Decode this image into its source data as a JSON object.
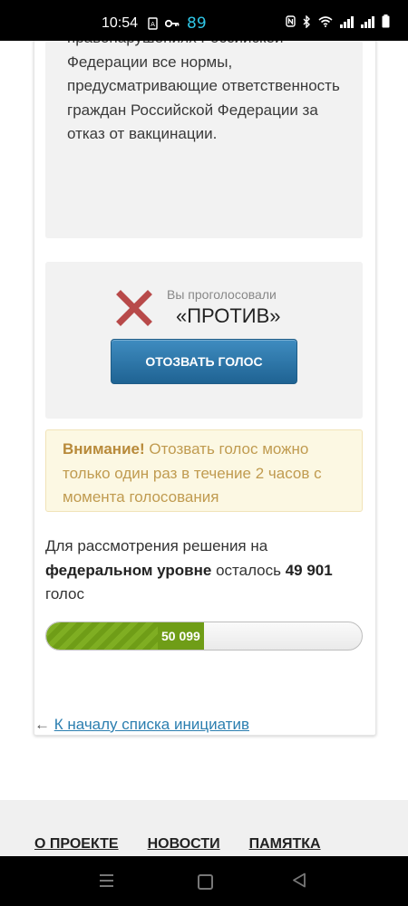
{
  "status_bar": {
    "time": "10:54",
    "battery": "89"
  },
  "petition": {
    "text": "правонарушениях Российской Федерации все нормы, предусматривающие ответственность граждан Российской Федерации за отказ от вакцинации."
  },
  "vote": {
    "label": "Вы проголосовали",
    "value": "«ПРОТИВ»",
    "revoke_button": "ОТОЗВАТЬ ГОЛОС",
    "icon": "cross-icon",
    "icon_color": "#b84a4a"
  },
  "warning": {
    "title": "Внимание!",
    "text": " Отозвать голос можно только один раз в течение 2 часов с момента голосования"
  },
  "remaining": {
    "prefix": "Для рассмотрения решения на ",
    "level": "федеральном уровне",
    "middle": " осталось ",
    "count": "49 901",
    "suffix": " голос"
  },
  "progress": {
    "value_label": "50 099",
    "votes": 50099,
    "goal": 100000,
    "fill_color": "#6f9d17"
  },
  "back_link": {
    "arrow": "←",
    "text": "К началу списка инициатив"
  },
  "footer": {
    "nav": [
      "О ПРОЕКТЕ",
      "НОВОСТИ",
      "ПАМЯТКА"
    ]
  }
}
